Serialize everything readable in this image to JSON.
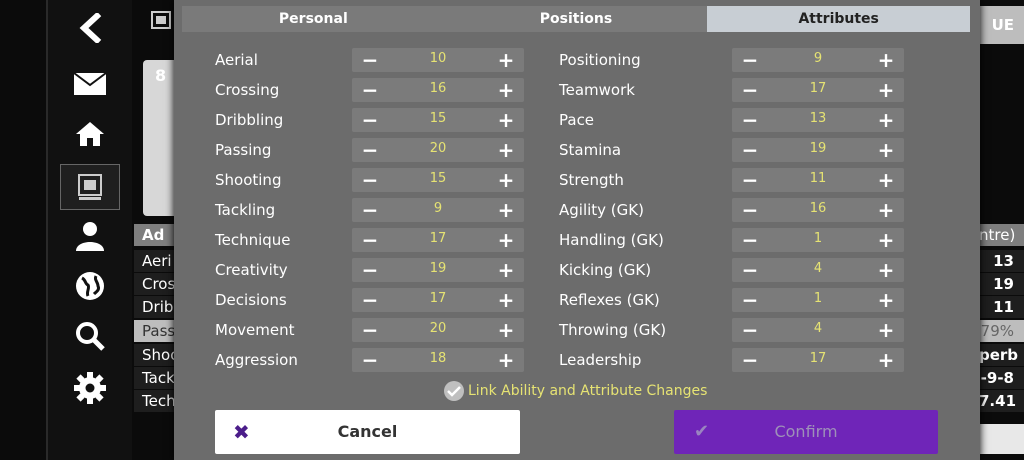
{
  "tabs": [
    "Personal",
    "Positions",
    "Attributes"
  ],
  "active_tab": "Attributes",
  "left_attributes": [
    {
      "name": "Aerial",
      "value": 10
    },
    {
      "name": "Crossing",
      "value": 16
    },
    {
      "name": "Dribbling",
      "value": 15
    },
    {
      "name": "Passing",
      "value": 20
    },
    {
      "name": "Shooting",
      "value": 15
    },
    {
      "name": "Tackling",
      "value": 9
    },
    {
      "name": "Technique",
      "value": 17
    },
    {
      "name": "Creativity",
      "value": 19
    },
    {
      "name": "Decisions",
      "value": 17
    },
    {
      "name": "Movement",
      "value": 20
    },
    {
      "name": "Aggression",
      "value": 18
    }
  ],
  "right_attributes": [
    {
      "name": "Positioning",
      "value": 9
    },
    {
      "name": "Teamwork",
      "value": 17
    },
    {
      "name": "Pace",
      "value": 13
    },
    {
      "name": "Stamina",
      "value": 19
    },
    {
      "name": "Strength",
      "value": 11
    },
    {
      "name": "Agility (GK)",
      "value": 16
    },
    {
      "name": "Handling (GK)",
      "value": 1
    },
    {
      "name": "Kicking (GK)",
      "value": 4
    },
    {
      "name": "Reflexes (GK)",
      "value": 1
    },
    {
      "name": "Throwing (GK)",
      "value": 4
    },
    {
      "name": "Leadership",
      "value": 17
    }
  ],
  "minus_symbol": "−",
  "plus_symbol": "+",
  "link_label": "Link Ability and Attribute Changes",
  "link_checked": true,
  "cancel_label": "Cancel",
  "confirm_label": "Confirm",
  "background": {
    "card_number": "8",
    "table_head": "Ad",
    "rows": [
      "Aeri",
      "Cros",
      "Drib",
      "Pass",
      "Shoo",
      "Tack",
      "Tech"
    ],
    "right_head": "ntre)",
    "right_values": [
      "13",
      "19",
      "11",
      "79%",
      "perb",
      "-9-8",
      "7.41"
    ],
    "top_right_label": "UE"
  },
  "icons": {
    "back": "back-chevron-icon",
    "mail": "mail-icon",
    "home": "home-icon",
    "club": "club-crest-icon",
    "player": "player-icon",
    "globe": "globe-icon",
    "search": "search-icon",
    "settings": "settings-gear-icon"
  },
  "colors": {
    "modal_bg": "#6c6c6c",
    "value_yellow": "#e6e373",
    "confirm_purple": "#6f25b8",
    "active_tab": "#c8ced4"
  }
}
